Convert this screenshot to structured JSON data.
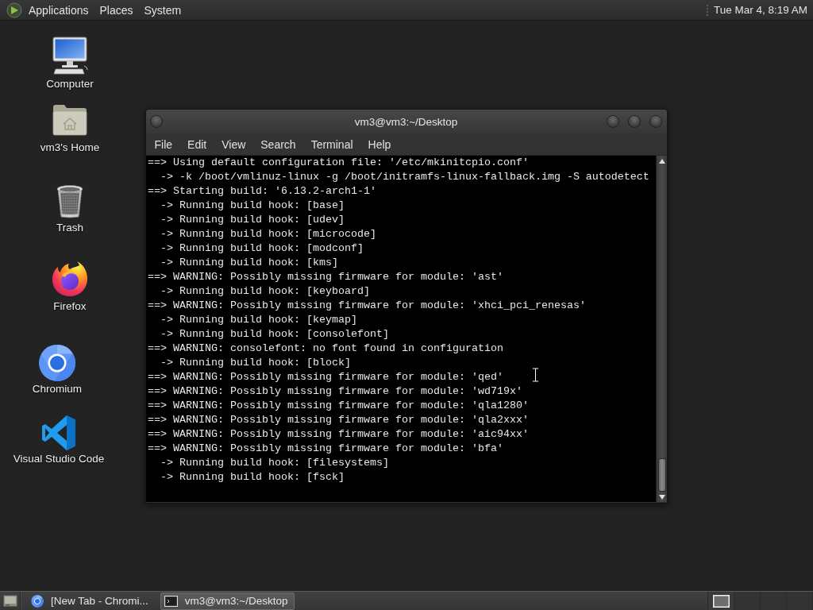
{
  "top_panel": {
    "menus": [
      "Applications",
      "Places",
      "System"
    ],
    "clock": "Tue Mar 4, 8:19 AM"
  },
  "desktop_icons": [
    {
      "kind": "computer",
      "label": "Computer"
    },
    {
      "kind": "home",
      "label": "vm3's Home"
    },
    {
      "kind": "trash",
      "label": "Trash"
    },
    {
      "kind": "firefox",
      "label": "Firefox"
    },
    {
      "kind": "chromium",
      "label": "Chromium"
    },
    {
      "kind": "vscode",
      "label": "Visual Studio Code"
    }
  ],
  "terminal_window": {
    "title": "vm3@vm3:~/Desktop",
    "menu": [
      "File",
      "Edit",
      "View",
      "Search",
      "Terminal",
      "Help"
    ],
    "lines": [
      "==> Using default configuration file: '/etc/mkinitcpio.conf'",
      "  -> -k /boot/vmlinuz-linux -g /boot/initramfs-linux-fallback.img -S autodetect",
      "==> Starting build: '6.13.2-arch1-1'",
      "  -> Running build hook: [base]",
      "  -> Running build hook: [udev]",
      "  -> Running build hook: [microcode]",
      "  -> Running build hook: [modconf]",
      "  -> Running build hook: [kms]",
      "==> WARNING: Possibly missing firmware for module: 'ast'",
      "  -> Running build hook: [keyboard]",
      "==> WARNING: Possibly missing firmware for module: 'xhci_pci_renesas'",
      "  -> Running build hook: [keymap]",
      "  -> Running build hook: [consolefont]",
      "==> WARNING: consolefont: no font found in configuration",
      "  -> Running build hook: [block]",
      "==> WARNING: Possibly missing firmware for module: 'qed'",
      "==> WARNING: Possibly missing firmware for module: 'wd719x'",
      "==> WARNING: Possibly missing firmware for module: 'qla1280'",
      "==> WARNING: Possibly missing firmware for module: 'qla2xxx'",
      "==> WARNING: Possibly missing firmware for module: 'aic94xx'",
      "==> WARNING: Possibly missing firmware for module: 'bfa'",
      "  -> Running build hook: [filesystems]",
      "  -> Running build hook: [fsck]"
    ]
  },
  "taskbar": {
    "tasks": [
      {
        "kind": "chromium",
        "label": "[New Tab - Chromi...",
        "selected": false
      },
      {
        "kind": "terminal",
        "label": "vm3@vm3:~/Desktop",
        "selected": true
      }
    ]
  }
}
